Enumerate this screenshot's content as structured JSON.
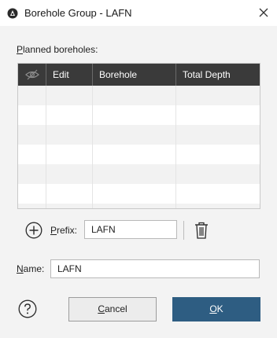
{
  "window": {
    "title": "Borehole Group - LAFN",
    "app_icon": "leapfrog-app-icon",
    "close_icon": "close-icon"
  },
  "planned": {
    "label_first": "P",
    "label_rest": "lanned boreholes:"
  },
  "table": {
    "columns": [
      {
        "id": "visibility",
        "label": "",
        "icon": "eye-slash-icon"
      },
      {
        "id": "edit",
        "label": "Edit"
      },
      {
        "id": "borehole",
        "label": "Borehole"
      },
      {
        "id": "total_depth",
        "label": "Total Depth"
      }
    ],
    "rows": [],
    "header_bg": "#3a3a3a",
    "alt_row_bg": "#f2f2f2"
  },
  "prefix": {
    "label_first": "P",
    "label_rest": "refix:",
    "value": "LAFN",
    "add_icon": "plus-circle-icon",
    "delete_icon": "trash-icon"
  },
  "name": {
    "label_first": "N",
    "label_rest": "ame:",
    "value": "LAFN"
  },
  "buttons": {
    "help_icon": "help-circle-icon",
    "cancel_first": "C",
    "cancel_rest": "ancel",
    "ok_first": "O",
    "ok_rest": "K",
    "ok_bg": "#2e5d82"
  }
}
